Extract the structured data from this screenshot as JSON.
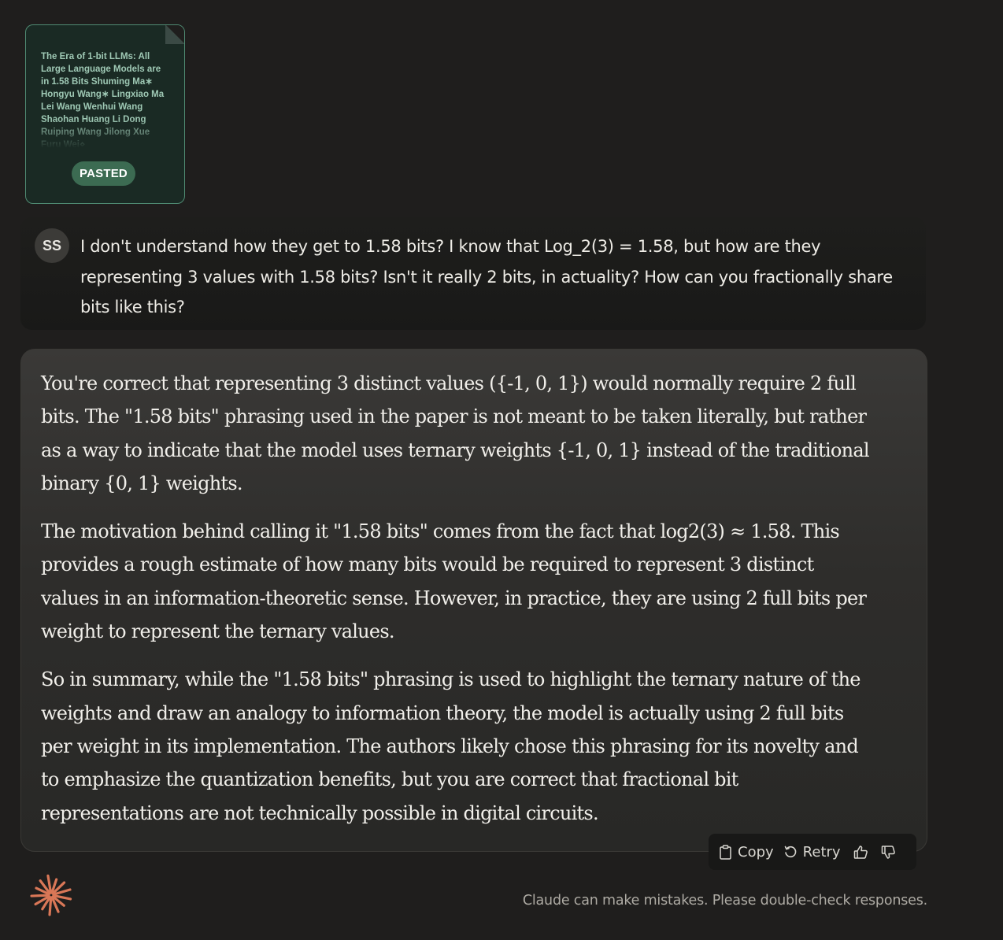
{
  "pasted": {
    "preview_lines": [
      "The Era of 1-bit LLMs: All",
      "Large Language Models are",
      "in 1.58 Bits Shuming Ma∗",
      "Hongyu Wang∗ Lingxiao Ma",
      "Lei Wang Wenhui Wang",
      "Shaohan Huang Li Dong",
      "Ruiping Wang Jilong Xue",
      "Furu Wei⋄"
    ],
    "badge": "PASTED"
  },
  "user": {
    "initials": "SS",
    "message": "I don't understand how they get to 1.58 bits? I know that Log_2(3) = 1.58, but how are they representing 3 values with 1.58 bits? Isn't it really 2 bits, in actuality? How can you fractionally share bits like this?"
  },
  "assistant": {
    "paragraphs": [
      "You're correct that representing 3 distinct values ({-1, 0, 1}) would normally require 2 full bits. The \"1.58 bits\" phrasing used in the paper is not meant to be taken literally, but rather as a way to indicate that the model uses ternary weights {-1, 0, 1} instead of the traditional binary {0, 1} weights.",
      "The motivation behind calling it \"1.58 bits\" comes from the fact that log2(3) ≈ 1.58. This provides a rough estimate of how many bits would be required to represent 3 distinct values in an information-theoretic sense. However, in practice, they are using 2 full bits per weight to represent the ternary values.",
      "So in summary, while the \"1.58 bits\" phrasing is used to highlight the ternary nature of the weights and draw an analogy to information theory, the model is actually using 2 full bits per weight in its implementation. The authors likely chose this phrasing for its novelty and to emphasize the quantization benefits, but you are correct that fractional bit representations are not technically possible in digital circuits."
    ]
  },
  "toolbar": {
    "copy_label": "Copy",
    "retry_label": "Retry",
    "icons": [
      "clipboard-icon",
      "retry-icon",
      "thumbs-up-icon",
      "thumbs-down-icon"
    ]
  },
  "footer": {
    "disclaimer": "Claude can make mistakes. Please double-check responses.",
    "logo_icon": "claude-starburst-icon",
    "logo_color": "#d97757"
  },
  "colors": {
    "background": "#1f1e1d",
    "pasted_border": "#4f8a72",
    "pasted_badge": "#3c6b52",
    "accent": "#d97757"
  }
}
